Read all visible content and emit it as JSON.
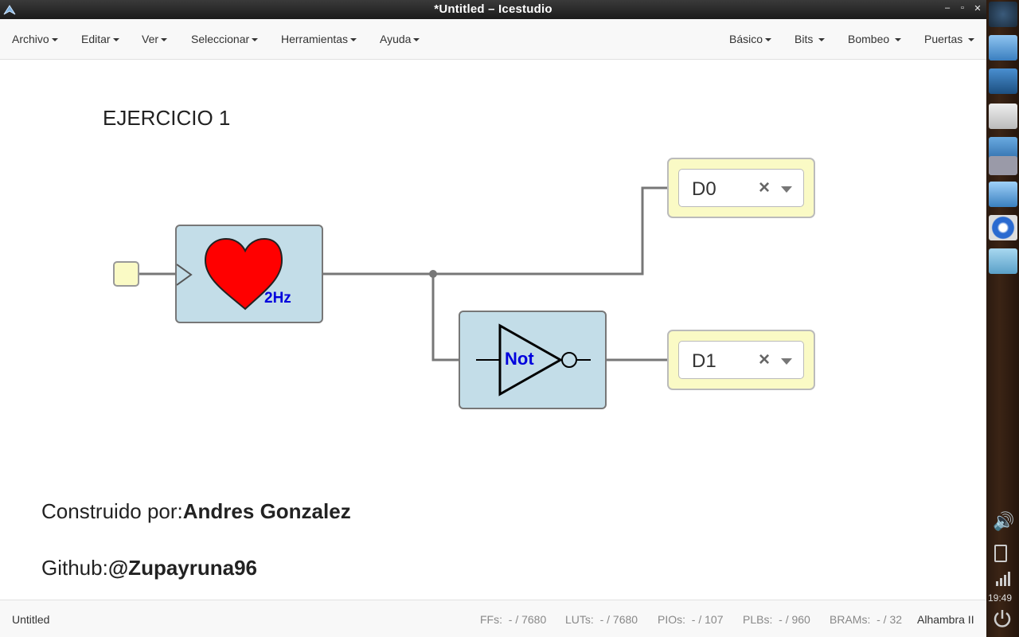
{
  "window": {
    "title": "*Untitled – Icestudio"
  },
  "menu_left": [
    "Archivo",
    "Editar",
    "Ver",
    "Seleccionar",
    "Herramientas",
    "Ayuda"
  ],
  "menu_right": [
    "Básico",
    "Bits",
    "Bombeo",
    "Puertas"
  ],
  "canvas": {
    "heading": "EJERCICIO 1",
    "clock_label": "2Hz",
    "not_label": "Not",
    "output_d0": "D0",
    "output_d1": "D1",
    "clear_glyph": "×",
    "credit_prefix": "Construido por:",
    "credit_name": "Andres Gonzalez",
    "github_prefix": "Github:",
    "github_handle": "@Zupayruna96"
  },
  "status": {
    "file": "Untitled",
    "ffs_label": "FFs:",
    "ffs_value": "- / 7680",
    "luts_label": "LUTs:",
    "luts_value": "- / 7680",
    "pios_label": "PIOs:",
    "pios_value": "- / 107",
    "plbs_label": "PLBs:",
    "plbs_value": "- / 960",
    "brams_label": "BRAMs:",
    "brams_value": "- / 32",
    "board": "Alhambra II"
  },
  "dock": {
    "clock_time": "19:49"
  },
  "colors": {
    "block_fill": "#c3dde8",
    "io_fill": "#fafac5",
    "wire": "#777777",
    "label_blue": "#0000dd",
    "heart": "#ff0000"
  },
  "icons": [
    "icestudio-icon",
    "minimize-icon",
    "maximize-icon",
    "close-icon",
    "heart-icon",
    "not-gate-icon",
    "clear-icon",
    "dropdown-arrow-icon",
    "volume-icon",
    "battery-icon",
    "signal-icon",
    "power-icon"
  ]
}
